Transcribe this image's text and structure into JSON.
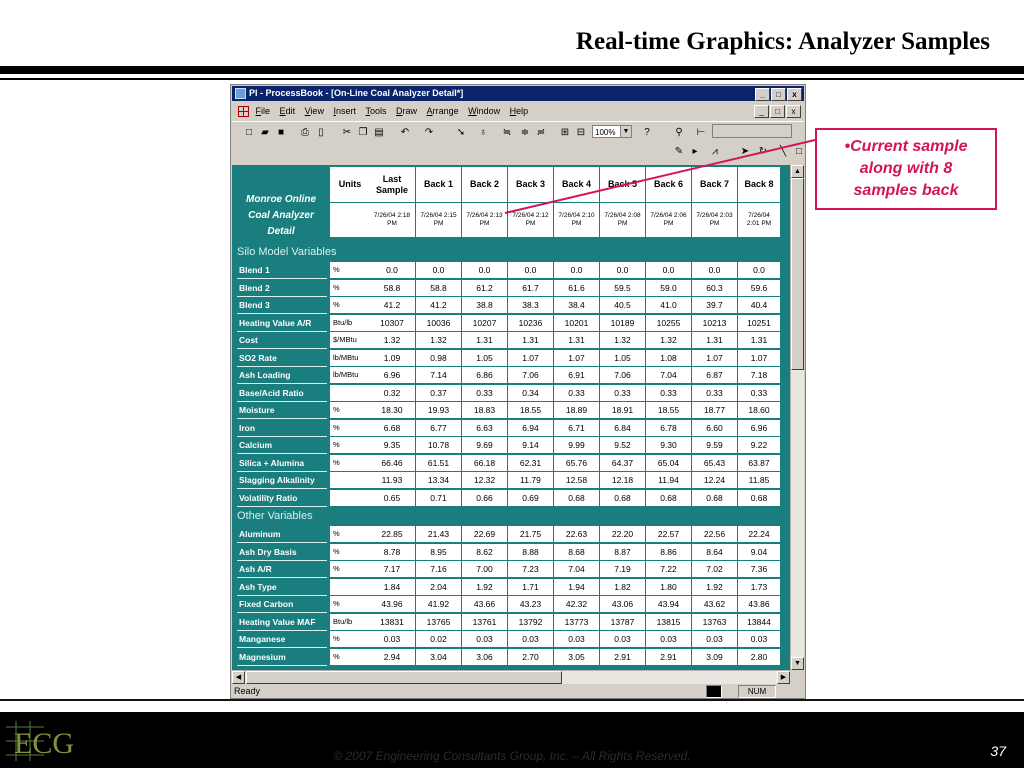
{
  "slide": {
    "title": "Real-time Graphics: Analyzer Samples",
    "footer": "© 2007 Engineering Consultants Group, Inc. – All Rights Reserved.",
    "page_number": "37",
    "logo_text": "ECG"
  },
  "callout": {
    "line1": "•Current sample",
    "line2": "along with 8",
    "line3": "samples back",
    "color": "#d4145a"
  },
  "window": {
    "title": "PI - ProcessBook - [On-Line Coal Analyzer Detail*]",
    "title_buttons": [
      "_",
      "□",
      "x"
    ],
    "menu": [
      "File",
      "Edit",
      "View",
      "Insert",
      "Tools",
      "Draw",
      "Arrange",
      "Window",
      "Help"
    ],
    "zoom": "100%",
    "status": "Ready",
    "status_indicators": [
      "NUM"
    ]
  },
  "toolbar_icons": [
    "new-icon",
    "open-icon",
    "save-icon",
    "print-icon",
    "print-preview-icon",
    "cut-icon",
    "copy-icon",
    "paste-icon",
    "undo-icon",
    "redo-icon",
    "help-icon"
  ],
  "display": {
    "title_lines": [
      "Monroe Online",
      "Coal Analyzer",
      "Detail"
    ],
    "background": "#1b7e7e",
    "columns": [
      {
        "label": "Units",
        "time": ""
      },
      {
        "label": "Last Sample",
        "time": "7/26/04 2:18 PM"
      },
      {
        "label": "Back 1",
        "time": "7/26/04 2:15 PM"
      },
      {
        "label": "Back 2",
        "time": "7/26/04 2:13 PM"
      },
      {
        "label": "Back 3",
        "time": "7/26/04 2:12 PM"
      },
      {
        "label": "Back 4",
        "time": "7/26/04 2:10 PM"
      },
      {
        "label": "Back 5",
        "time": "7/26/04 2:08 PM"
      },
      {
        "label": "Back 6",
        "time": "7/26/04 2:06 PM"
      },
      {
        "label": "Back 7",
        "time": "7/26/04 2:03 PM"
      },
      {
        "label": "Back 8",
        "time": "7/26/04 2:01 PM"
      }
    ],
    "sections": [
      {
        "name": "Silo Model Variables",
        "rows": [
          {
            "label": "Blend 1",
            "unit": "%",
            "values": [
              "0.0",
              "0.0",
              "0.0",
              "0.0",
              "0.0",
              "0.0",
              "0.0",
              "0.0",
              "0.0"
            ]
          },
          {
            "label": "Blend 2",
            "unit": "%",
            "values": [
              "58.8",
              "58.8",
              "61.2",
              "61.7",
              "61.6",
              "59.5",
              "59.0",
              "60.3",
              "59.6"
            ]
          },
          {
            "label": "Blend 3",
            "unit": "%",
            "values": [
              "41.2",
              "41.2",
              "38.8",
              "38.3",
              "38.4",
              "40.5",
              "41.0",
              "39.7",
              "40.4"
            ]
          },
          {
            "label": "Heating Value A/R",
            "unit": "Btu/lb",
            "values": [
              "10307",
              "10036",
              "10207",
              "10236",
              "10201",
              "10189",
              "10255",
              "10213",
              "10251"
            ]
          },
          {
            "label": "Cost",
            "unit": "$/MBtu",
            "values": [
              "1.32",
              "1.32",
              "1.31",
              "1.31",
              "1.31",
              "1.32",
              "1.32",
              "1.31",
              "1.31"
            ]
          },
          {
            "label": "SO2 Rate",
            "unit": "lb/MBtu",
            "values": [
              "1.09",
              "0.98",
              "1.05",
              "1.07",
              "1.07",
              "1.05",
              "1.08",
              "1.07",
              "1.07"
            ]
          },
          {
            "label": "Ash Loading",
            "unit": "lb/MBtu",
            "values": [
              "6.96",
              "7.14",
              "6.86",
              "7.06",
              "6.91",
              "7.06",
              "7.04",
              "6.87",
              "7.18"
            ]
          },
          {
            "label": "Base/Acid Ratio",
            "unit": "",
            "values": [
              "0.32",
              "0.37",
              "0.33",
              "0.34",
              "0.33",
              "0.33",
              "0.33",
              "0.33",
              "0.33"
            ]
          },
          {
            "label": "Moisture",
            "unit": "%",
            "values": [
              "18.30",
              "19.93",
              "18.83",
              "18.55",
              "18.89",
              "18.91",
              "18.55",
              "18.77",
              "18.60"
            ]
          },
          {
            "label": "Iron",
            "unit": "%",
            "values": [
              "6.68",
              "6.77",
              "6.63",
              "6.94",
              "6.71",
              "6.84",
              "6.78",
              "6.60",
              "6.96"
            ]
          },
          {
            "label": "Calcium",
            "unit": "%",
            "values": [
              "9.35",
              "10.78",
              "9.69",
              "9.14",
              "9.99",
              "9.52",
              "9.30",
              "9.59",
              "9.22"
            ]
          },
          {
            "label": "Silica + Alumina",
            "unit": "%",
            "values": [
              "66.46",
              "61.51",
              "66.18",
              "62.31",
              "65.76",
              "64.37",
              "65.04",
              "65.43",
              "63.87"
            ]
          },
          {
            "label": "Slagging Alkalinity",
            "unit": "",
            "values": [
              "11.93",
              "13.34",
              "12.32",
              "11.79",
              "12.58",
              "12.18",
              "11.94",
              "12.24",
              "11.85"
            ]
          },
          {
            "label": "Volatility Ratio",
            "unit": "",
            "values": [
              "0.65",
              "0.71",
              "0.66",
              "0.69",
              "0.68",
              "0.68",
              "0.68",
              "0.68",
              "0.68"
            ]
          }
        ]
      },
      {
        "name": "Other Variables",
        "rows": [
          {
            "label": "Aluminum",
            "unit": "%",
            "values": [
              "22.85",
              "21.43",
              "22.69",
              "21.75",
              "22.63",
              "22.20",
              "22.57",
              "22.56",
              "22.24"
            ]
          },
          {
            "label": "Ash Dry Basis",
            "unit": "%",
            "values": [
              "8.78",
              "8.95",
              "8.62",
              "8.88",
              "8.68",
              "8.87",
              "8.86",
              "8.64",
              "9.04"
            ]
          },
          {
            "label": "Ash A/R",
            "unit": "%",
            "values": [
              "7.17",
              "7.16",
              "7.00",
              "7.23",
              "7.04",
              "7.19",
              "7.22",
              "7.02",
              "7.36"
            ]
          },
          {
            "label": "Ash Type",
            "unit": "",
            "values": [
              "1.84",
              "2.04",
              "1.92",
              "1.71",
              "1.94",
              "1.82",
              "1.80",
              "1.92",
              "1.73"
            ]
          },
          {
            "label": "Fixed Carbon",
            "unit": "%",
            "values": [
              "43.96",
              "41.92",
              "43.66",
              "43.23",
              "42.32",
              "43.06",
              "43.94",
              "43.62",
              "43.86"
            ]
          },
          {
            "label": "Heating Value MAF",
            "unit": "Btu/lb",
            "values": [
              "13831",
              "13765",
              "13761",
              "13792",
              "13773",
              "13787",
              "13815",
              "13763",
              "13844"
            ]
          },
          {
            "label": "Manganese",
            "unit": "%",
            "values": [
              "0.03",
              "0.02",
              "0.03",
              "0.03",
              "0.03",
              "0.03",
              "0.03",
              "0.03",
              "0.03"
            ]
          },
          {
            "label": "Magnesium",
            "unit": "%",
            "values": [
              "2.94",
              "3.04",
              "3.06",
              "2.70",
              "3.05",
              "2.91",
              "2.91",
              "3.09",
              "2.80"
            ]
          }
        ]
      }
    ]
  }
}
